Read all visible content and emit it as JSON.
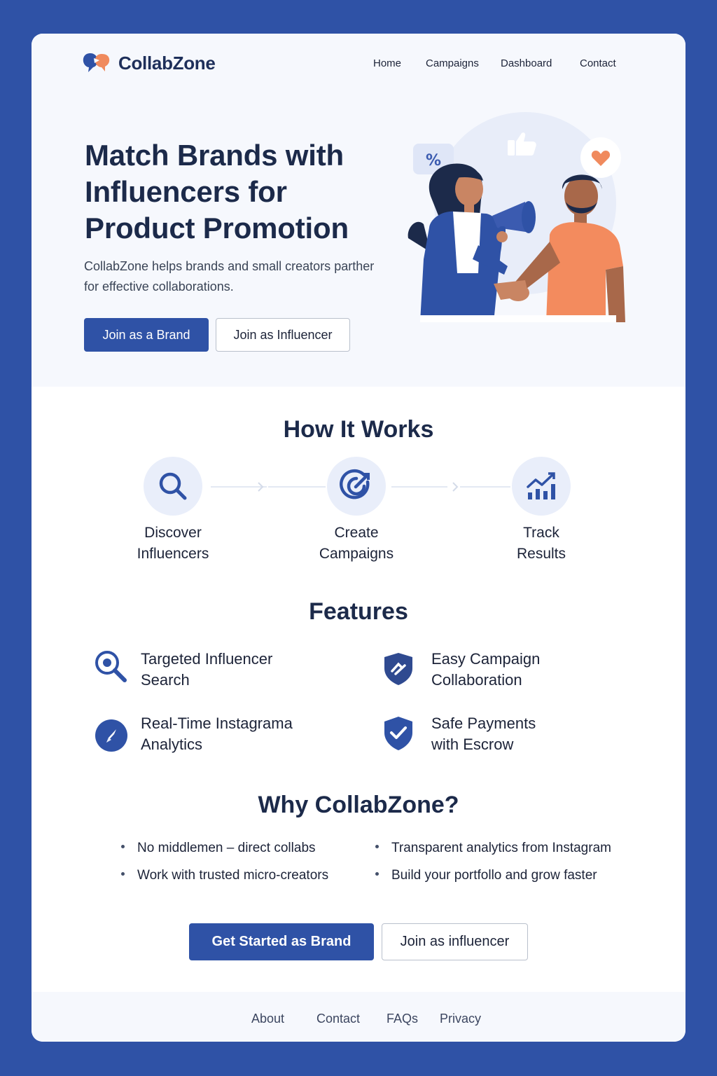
{
  "brand": {
    "name": "CollabZone"
  },
  "nav": {
    "items": [
      "Home",
      "Campaigns",
      "Dashboard",
      "Contact"
    ]
  },
  "hero": {
    "title": "Match Brands with Influencers for Product Promotion",
    "subtitle": "CollabZone helps brands and small creators parther for effective collaborations.",
    "primary_button": "Join as a Brand",
    "secondary_button": "Join as Influencer"
  },
  "how": {
    "title": "How It Works",
    "steps": [
      {
        "label": "Discover Influencers",
        "icon": "search-icon"
      },
      {
        "label": "Create Campaigns",
        "icon": "target-icon"
      },
      {
        "label": "Track Results",
        "icon": "chart-up-icon"
      }
    ]
  },
  "features": {
    "title": "Features",
    "items": [
      {
        "label": "Targeted Influencer Search",
        "icon": "magnifier-icon"
      },
      {
        "label": "Easy Campaign Collaboration",
        "icon": "shield-handshake-icon"
      },
      {
        "label": "Real-Time Instagrama Analytics",
        "icon": "compass-icon"
      },
      {
        "label": "Safe Payments with Escrow",
        "icon": "shield-check-icon"
      }
    ]
  },
  "why": {
    "title": "Why CollabZone?",
    "items": [
      "No middlemen – direct collabs",
      "Transparent analytics from Instagram",
      "Work with trusted micro-creators",
      "Build your portfollo and grow faster"
    ]
  },
  "cta": {
    "primary_button": "Get Started as Brand",
    "secondary_button": "Join as influencer"
  },
  "footer": {
    "links": [
      "About",
      "Contact",
      "FAQs",
      "Privacy"
    ]
  },
  "colors": {
    "accent": "#2f52a6",
    "text": "#1c2a4a",
    "hero_bg": "#f6f8fd",
    "orange": "#f08a5d"
  }
}
